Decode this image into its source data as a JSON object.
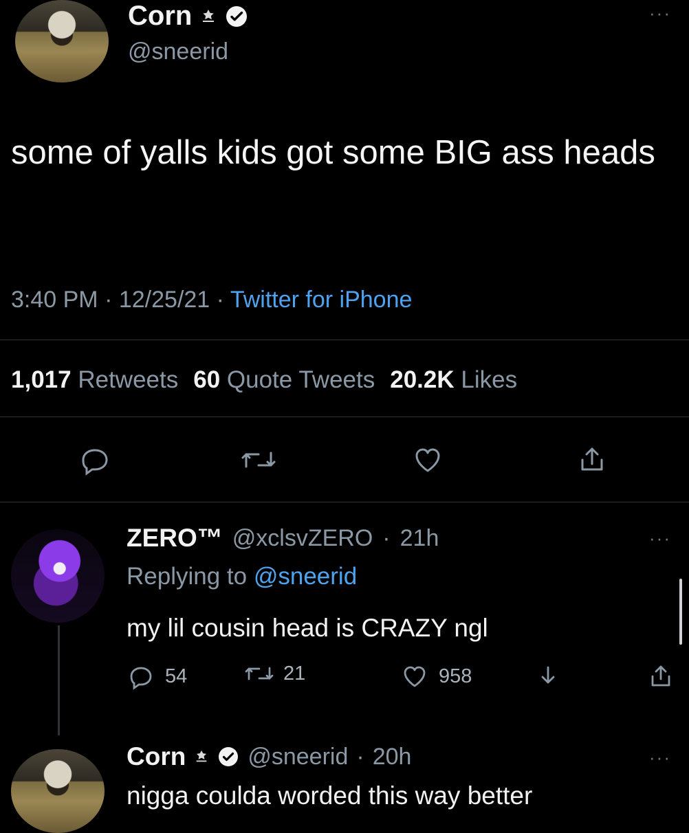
{
  "main_tweet": {
    "author_name": "Corn",
    "handle": "@sneerid",
    "text": "some of yalls kids got some BIG ass heads",
    "time": "3:40 PM",
    "date": "12/25/21",
    "source": "Twitter for iPhone",
    "retweets_count": "1,017",
    "retweets_label": "Retweets",
    "quote_count": "60",
    "quote_label": "Quote Tweets",
    "likes_count": "20.2K",
    "likes_label": "Likes",
    "more_label": "···"
  },
  "reply_1": {
    "author_name": "ZERO™",
    "handle": "@xclsvZERO",
    "time_ago": "21h",
    "replying_prefix": "Replying to",
    "replying_handle": "@sneerid",
    "text": "my lil cousin head is CRAZY ngl",
    "reply_count": "54",
    "retweet_count": "21",
    "like_count": "958",
    "more_label": "···"
  },
  "reply_2": {
    "author_name": "Corn",
    "handle": "@sneerid",
    "time_ago": "20h",
    "text": "nigga coulda worded this way better",
    "more_label": "···"
  },
  "colors": {
    "background": "#000000",
    "text": "#f2f2f2",
    "secondary": "#8b98a5",
    "link": "#4ea3f1",
    "divider": "#2f3336"
  },
  "icons": {
    "reply": "reply-icon",
    "retweet": "retweet-icon",
    "like": "heart-icon",
    "share": "share-icon",
    "verified": "verified-icon",
    "badge": "badge-icon",
    "download": "download-icon"
  }
}
